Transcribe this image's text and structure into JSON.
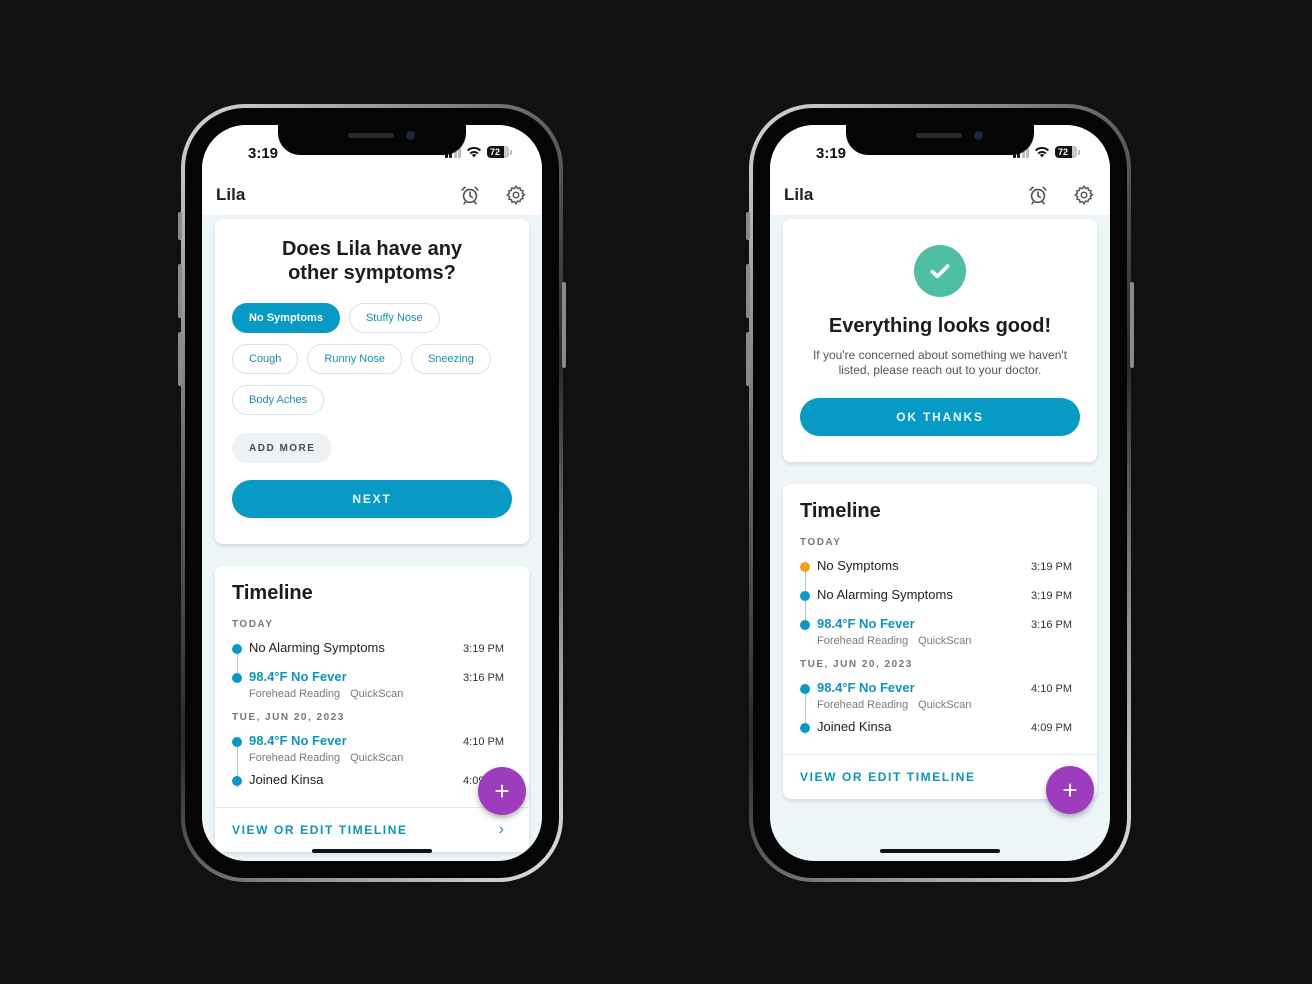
{
  "status_bar": {
    "time": "3:19",
    "battery": "72"
  },
  "header": {
    "profile_name": "Lila",
    "icons": [
      "alarm-clock-icon",
      "gear-icon"
    ]
  },
  "left_screen": {
    "question": {
      "title_line1": "Does Lila have any",
      "title_line2": "other symptoms?",
      "chips": [
        {
          "label": "No Symptoms",
          "selected": true
        },
        {
          "label": "Stuffy Nose",
          "selected": false
        },
        {
          "label": "Cough",
          "selected": false
        },
        {
          "label": "Runny Nose",
          "selected": false
        },
        {
          "label": "Sneezing",
          "selected": false
        },
        {
          "label": "Body Aches",
          "selected": false
        }
      ],
      "add_more_label": "ADD MORE",
      "next_label": "NEXT"
    },
    "timeline": {
      "title": "Timeline",
      "sections": [
        {
          "heading": "TODAY",
          "items": [
            {
              "label": "No Alarming Symptoms",
              "time": "3:19 PM",
              "type": "normal"
            },
            {
              "label": "98.4°F No Fever",
              "time": "3:16 PM",
              "type": "reading",
              "sub": [
                "Forehead Reading",
                "QuickScan"
              ]
            }
          ]
        },
        {
          "heading": "TUE, JUN 20, 2023",
          "items": [
            {
              "label": "98.4°F No Fever",
              "time": "4:10 PM",
              "type": "reading",
              "sub": [
                "Forehead Reading",
                "QuickScan"
              ]
            },
            {
              "label": "Joined Kinsa",
              "time": "4:09 PM",
              "type": "normal"
            }
          ]
        }
      ],
      "footer_link": "VIEW OR EDIT TIMELINE",
      "fab_label": "+"
    }
  },
  "right_screen": {
    "result": {
      "icon": "check-icon",
      "title": "Everything looks good!",
      "message": "If you're concerned about something we haven't listed, please reach out to your doctor.",
      "button_label": "OK THANKS"
    },
    "timeline": {
      "title": "Timeline",
      "sections": [
        {
          "heading": "TODAY",
          "items": [
            {
              "label": "No Symptoms",
              "time": "3:19 PM",
              "type": "symptom"
            },
            {
              "label": "No Alarming Symptoms",
              "time": "3:19 PM",
              "type": "normal"
            },
            {
              "label": "98.4°F No Fever",
              "time": "3:16 PM",
              "type": "reading",
              "sub": [
                "Forehead Reading",
                "QuickScan"
              ]
            }
          ]
        },
        {
          "heading": "TUE, JUN 20, 2023",
          "items": [
            {
              "label": "98.4°F No Fever",
              "time": "4:10 PM",
              "type": "reading",
              "sub": [
                "Forehead Reading",
                "QuickScan"
              ]
            },
            {
              "label": "Joined Kinsa",
              "time": "4:09 PM",
              "type": "normal"
            }
          ]
        }
      ],
      "footer_link": "VIEW OR EDIT TIMELINE",
      "fab_label": "+"
    }
  },
  "colors": {
    "primary": "#069ac5",
    "success": "#4fbfa4",
    "fab": "#9d3dbd",
    "symptom_dot": "#f4a11c"
  }
}
